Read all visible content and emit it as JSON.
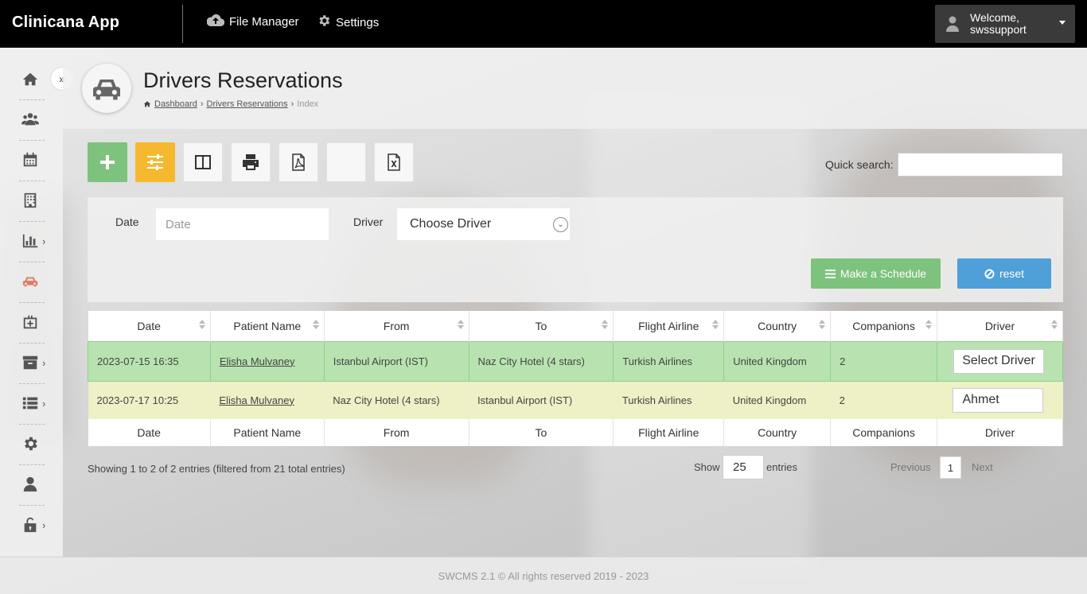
{
  "app": {
    "brand": "Clinicana App"
  },
  "topnav": {
    "file_manager": "File Manager",
    "settings": "Settings"
  },
  "user": {
    "greeting": "Welcome,",
    "username": "swssupport"
  },
  "page": {
    "title": "Drivers Reservations",
    "breadcrumb": [
      "Dashboard",
      "Drivers Reservations",
      "Index"
    ]
  },
  "sidebar": {
    "items": [
      {
        "icon": "home-icon"
      },
      {
        "icon": "users-icon"
      },
      {
        "icon": "calendar-icon"
      },
      {
        "icon": "building-icon"
      },
      {
        "icon": "chart-icon",
        "has_submenu": true
      },
      {
        "icon": "car-icon",
        "active": true
      },
      {
        "icon": "medkit-icon"
      },
      {
        "icon": "archive-icon",
        "has_submenu": true
      },
      {
        "icon": "list-icon",
        "has_submenu": true
      },
      {
        "icon": "gear-icon"
      },
      {
        "icon": "user-icon"
      },
      {
        "icon": "unlock-icon",
        "has_submenu": true
      }
    ]
  },
  "toolbar": {
    "quick_search_label": "Quick search:",
    "quick_search_value": ""
  },
  "filters": {
    "date_label": "Date",
    "date_placeholder": "Date",
    "driver_label": "Driver",
    "driver_selected": "Choose Driver",
    "schedule_button": "Make a Schedule",
    "reset_button": "reset"
  },
  "table": {
    "columns": [
      "Date",
      "Patient Name",
      "From",
      "To",
      "Flight Airline",
      "Country",
      "Companions",
      "Driver"
    ],
    "rows": [
      {
        "date": "2023-07-15 16:35",
        "patient": "Elisha Mulvaney",
        "from": "Istanbul Airport (IST)",
        "to": "Naz City Hotel (4 stars)",
        "airline": "Turkish Airlines",
        "country": "United Kingdom",
        "companions": "2",
        "driver": "Select Driver"
      },
      {
        "date": "2023-07-17 10:25",
        "patient": "Elisha Mulvaney",
        "from": "Naz City Hotel (4 stars)",
        "to": "Istanbul Airport (IST)",
        "airline": "Turkish Airlines",
        "country": "United Kingdom",
        "companions": "2",
        "driver": "Ahmet"
      }
    ]
  },
  "pagination": {
    "info": "Showing 1 to 2 of 2 entries (filtered from 21 total entries)",
    "show_label": "Show",
    "page_length": "25",
    "entries_label": "entries",
    "previous": "Previous",
    "current_page": "1",
    "next": "Next"
  },
  "footer": {
    "text": "SWCMS 2.1 © All rights reserved 2019 - 2023"
  },
  "colors": {
    "topbar": "#000000",
    "success": "#7dc27d",
    "warning": "#f5b92f",
    "info": "#4f9fd8",
    "active_icon": "#e07a62"
  }
}
